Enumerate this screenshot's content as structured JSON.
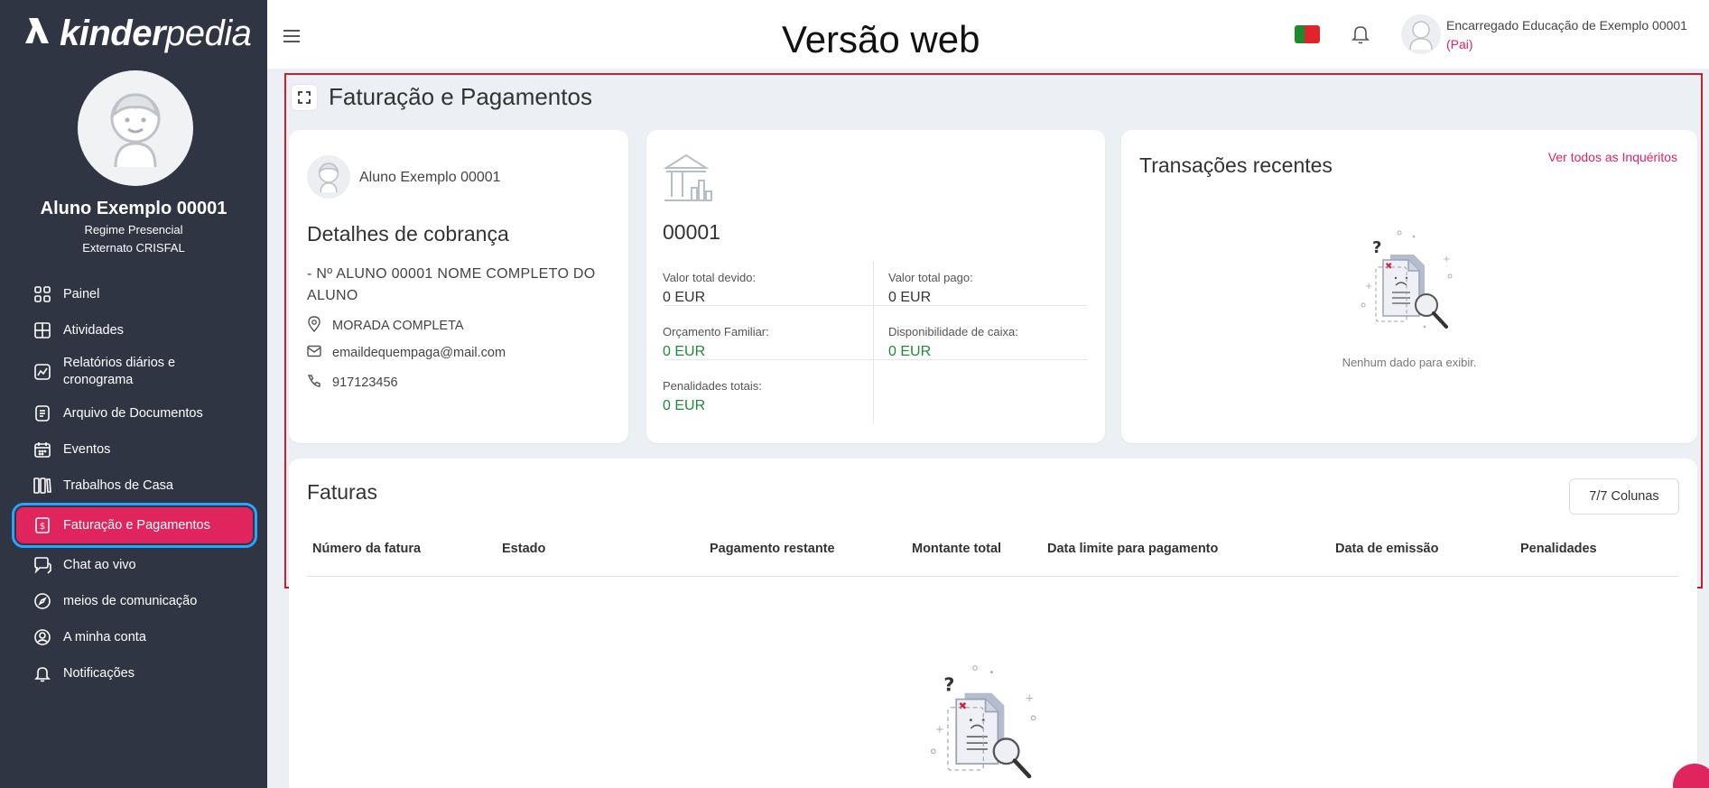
{
  "brand": {
    "mark": "ϡ",
    "word_bold": "kinder",
    "word_light": "pedia"
  },
  "student": {
    "name": "Aluno Exemplo 00001",
    "regime": "Regime Presencial",
    "school": "Externato CRISFAL"
  },
  "nav": [
    {
      "label": "Painel",
      "icon": "grid-icon"
    },
    {
      "label": "Atividades",
      "icon": "layout-icon"
    },
    {
      "label": "Relatórios diários e cronograma",
      "icon": "chart-icon"
    },
    {
      "label": "Arquivo de Documentos",
      "icon": "document-icon"
    },
    {
      "label": "Eventos",
      "icon": "calendar-icon"
    },
    {
      "label": "Trabalhos de Casa",
      "icon": "books-icon"
    },
    {
      "label": "Faturação e Pagamentos",
      "icon": "invoice-icon",
      "active": true
    },
    {
      "label": "Chat ao vivo",
      "icon": "chat-icon"
    },
    {
      "label": "meios de comunicação",
      "icon": "compass-icon"
    },
    {
      "label": "A minha conta",
      "icon": "user-circle-icon"
    },
    {
      "label": "Notificações",
      "icon": "bell-icon"
    }
  ],
  "topbar": {
    "version_title": "Versão web",
    "user_name": "Encarregado Educação de Exemplo 00001",
    "user_role": "(Pai)"
  },
  "page": {
    "title": "Faturação e Pagamentos"
  },
  "billing": {
    "student_name": "Aluno Exemplo 00001",
    "heading": "Detalhes de cobrança",
    "student_line": "- Nº ALUNO 00001 NOME COMPLETO DO ALUNO",
    "address": "MORADA COMPLETA",
    "email": "emaildequempaga@mail.com",
    "phone": "917123456"
  },
  "account": {
    "number": "00001",
    "total_due_label": "Valor total devido:",
    "total_due": "0 EUR",
    "total_paid_label": "Valor total pago:",
    "total_paid": "0 EUR",
    "family_budget_label": "Orçamento Familiar:",
    "family_budget": "0 EUR",
    "cash_label": "Disponibilidade de caixa:",
    "cash": "0 EUR",
    "penalties_label": "Penalidades totais:",
    "penalties": "0 EUR"
  },
  "transactions": {
    "heading": "Transações recentes",
    "link": "Ver todos as Inquéritos",
    "empty": "Nenhum dado para exibir."
  },
  "invoices": {
    "heading": "Faturas",
    "columns_button": "7/7 Colunas",
    "columns": [
      "Número da fatura",
      "Estado",
      "Pagamento restante",
      "Montante total",
      "Data limite para pagamento",
      "Data de emissão",
      "Penalidades"
    ]
  },
  "colors": {
    "accent": "#e0245e",
    "sidebar": "#2f3542",
    "positive": "#1f8a3a",
    "highlight": "#c8202e"
  }
}
